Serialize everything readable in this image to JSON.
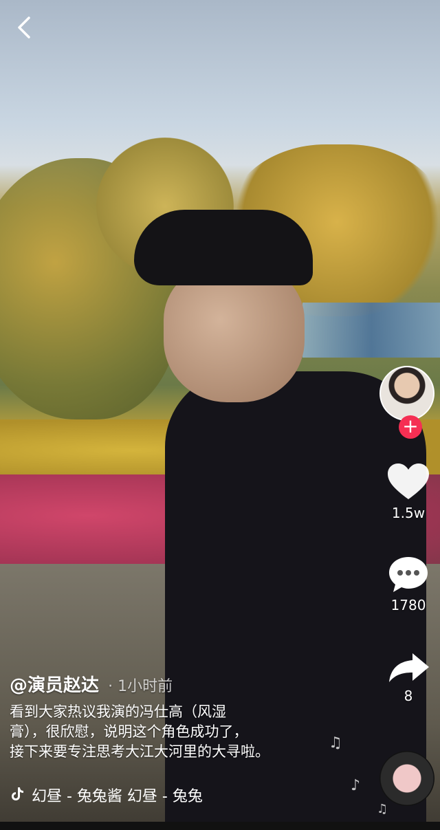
{
  "nav": {
    "back_icon": "chevron-left-icon"
  },
  "creator": {
    "avatar_icon": "avatar",
    "follow_label": "+"
  },
  "actions": {
    "like": {
      "icon": "heart-icon",
      "count": "1.5w"
    },
    "comment": {
      "icon": "comment-icon",
      "count": "1780"
    },
    "share": {
      "icon": "share-icon",
      "count": "8"
    }
  },
  "caption": {
    "author": "@演员赵达",
    "time": "· 1小时前",
    "lines": [
      "看到大家热议我演的冯仕高（风湿",
      "膏），很欣慰，说明这个角色成功了，",
      "接下来要专注思考大江大河里的大寻啦。"
    ]
  },
  "music": {
    "icon": "tiktok-note-icon",
    "text": "幻昼 - 兔兔酱    幻昼 - 兔兔"
  },
  "colors": {
    "follow": "#f52f53",
    "text": "#ffffff"
  }
}
